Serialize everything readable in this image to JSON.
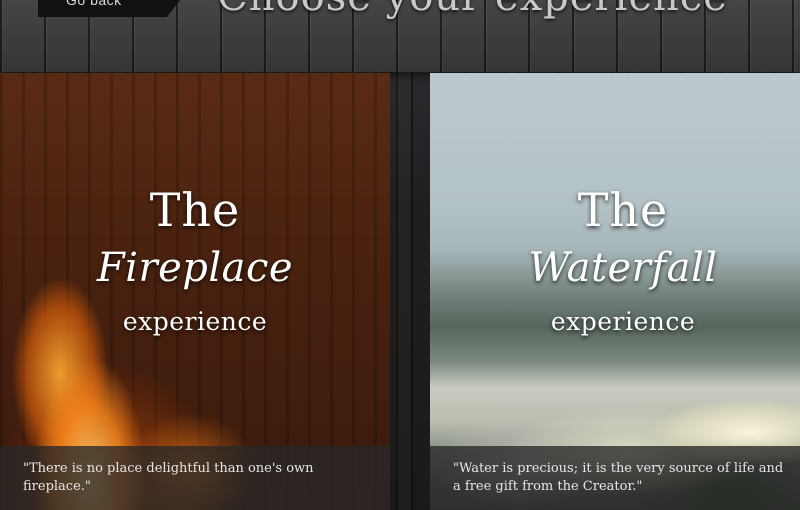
{
  "header": {
    "back_label": "Go back",
    "title": "Choose your experience"
  },
  "experiences": [
    {
      "the": "The",
      "name": "Fireplace",
      "suffix": "experience",
      "quote": "\"There is no place delightful than one's own fireplace.\""
    },
    {
      "the": "The",
      "name": "Waterfall",
      "suffix": "experience",
      "quote": "\"Water is precious; it is the very source of life and a free gift from the Creator.\""
    }
  ],
  "colors": {
    "title_text": "#c9c9c9",
    "card_title": "#ffffff",
    "quote_bg": "#282828"
  }
}
